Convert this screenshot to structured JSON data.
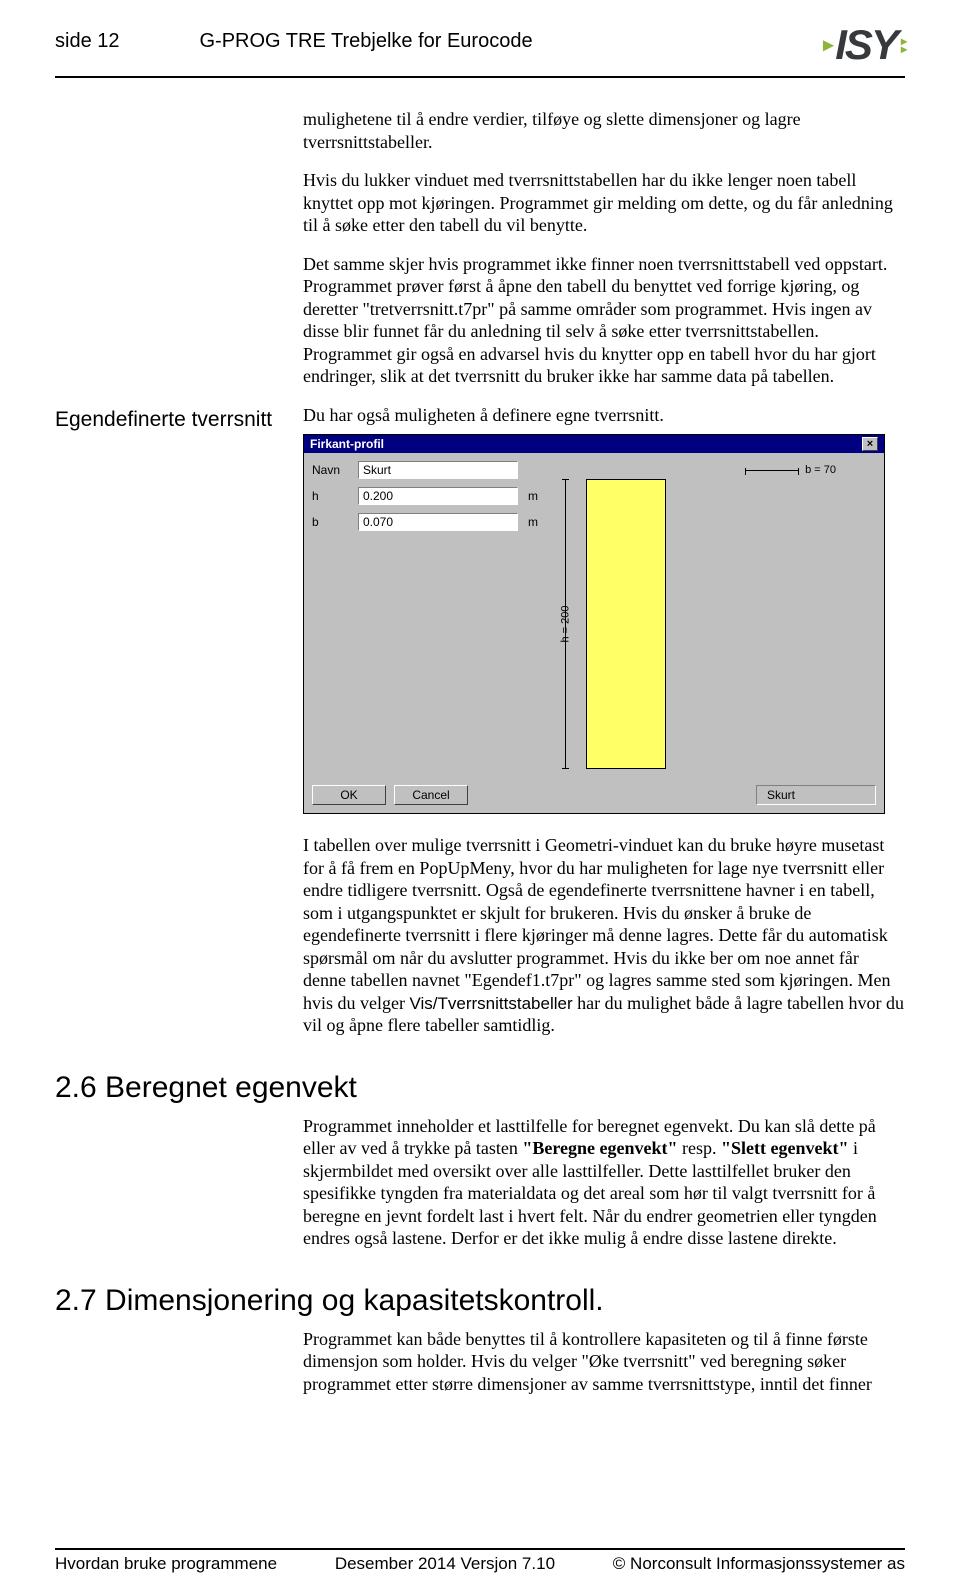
{
  "header": {
    "page_label": "side 12",
    "title": "G-PROG TRE Trebjelke for Eurocode",
    "logo_text": "ISY"
  },
  "content": {
    "p1": "mulighetene til å endre verdier, tilføye og slette dimensjoner og lagre tverrsnittstabeller.",
    "p2": "Hvis du lukker vinduet med tverrsnittstabellen har du ikke lenger noen tabell knyttet opp mot kjøringen. Programmet gir melding om dette, og du får anledning til å søke etter den tabell du vil benytte.",
    "p3": "Det samme skjer hvis programmet ikke finner noen tverrsnittstabell ved oppstart. Programmet prøver først å åpne den tabell du benyttet ved forrige kjøring, og deretter \"tretverrsnitt.t7pr\" på samme områder som programmet. Hvis ingen av disse blir funnet får du anledning til selv å søke etter tverrsnittstabellen. Programmet gir også en advarsel hvis du knytter opp en tabell hvor du har gjort endringer, slik at det tverrsnitt du bruker ikke har samme data på tabellen.",
    "side_heading": "Egendefinerte tverrsnitt",
    "p4": "Du har også muligheten å definere egne tverrsnitt.",
    "p5_a": "I tabellen over mulige tverrsnitt i Geometri-vinduet kan du bruke høyre musetast for å få frem en PopUpMeny, hvor du har muligheten for lage nye tverrsnitt eller endre tidligere tverrsnitt. Også de egendefinerte tverrsnittene havner i en tabell, som i utgangspunktet er skjult for brukeren. Hvis du ønsker å bruke de egendefinerte tverrsnitt i flere kjøringer må denne lagres. Dette får du automatisk spørsmål om når du avslutter programmet. Hvis du ikke ber om noe annet får denne tabellen navnet \"Egendef1.t7pr\" og lagres samme sted som kjøringen. Men hvis du velger ",
    "p5_bold": "Vis/Tverrsnittstabeller",
    "p5_b": " har du mulighet både å lagre tabellen hvor du vil og åpne flere tabeller samtidlig.",
    "h2_26": "2.6 Beregnet egenvekt",
    "p6_a": "Programmet inneholder et lasttilfelle for beregnet egenvekt. Du kan slå dette på eller av ved å trykke på tasten ",
    "p6_b1": "\"Beregne egenvekt\"",
    "p6_r": " resp. ",
    "p6_b2": "\"Slett egenvekt\"",
    "p6_c": " i skjermbildet med oversikt over alle lasttilfeller. Dette lasttilfellet bruker den spesifikke tyngden fra materialdata og det areal som hør til valgt tverrsnitt for å beregne en jevnt fordelt last i hvert felt. Når du endrer geometrien eller tyngden endres også lastene. Derfor er det ikke mulig å endre disse lastene direkte.",
    "h2_27": "2.7 Dimensjonering og kapasitetskontroll.",
    "p7": "Programmet kan både benyttes til å kontrollere kapasiteten og til å finne første dimensjon som holder. Hvis du velger \"Øke tverrsnitt\" ved beregning søker programmet etter større dimensjoner av samme tverrsnittstype, inntil det finner"
  },
  "dialog": {
    "title": "Firkant-profil",
    "close": "×",
    "navn_label": "Navn",
    "navn_value": "Skurt",
    "h_label": "h",
    "h_value": "0.200",
    "h_unit": "m",
    "b_label": "b",
    "b_value": "0.070",
    "b_unit": "m",
    "dim_b": "b = 70",
    "dim_h": "h = 200",
    "ok": "OK",
    "cancel": "Cancel",
    "status": "Skurt"
  },
  "footer": {
    "left": "Hvordan bruke programmene",
    "center": "Desember 2014 Versjon 7.10",
    "right": "© Norconsult Informasjonssystemer as"
  }
}
